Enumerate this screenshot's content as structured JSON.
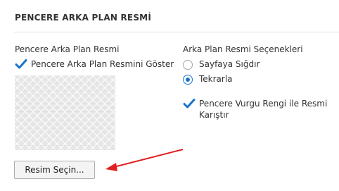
{
  "section": {
    "title": "PENCERE ARKA PLAN RESMİ"
  },
  "left": {
    "label": "Pencere Arka Plan Resmi",
    "show_checkbox": {
      "label": "Pencere Arka Plan Resmini Göster",
      "checked": true
    },
    "select_button": "Resim Seçin..."
  },
  "right": {
    "label": "Arka Plan Resmi Seçenekleri",
    "options": [
      {
        "label": "Sayfaya Sığdır",
        "selected": false
      },
      {
        "label": "Tekrarla",
        "selected": true
      }
    ],
    "blend_checkbox": {
      "line1": "Pencere Vurgu Rengi ile Resmi",
      "line2": "Karıştır",
      "checked": true
    }
  },
  "colors": {
    "accent": "#1a73c8",
    "arrow": "#e02020"
  }
}
